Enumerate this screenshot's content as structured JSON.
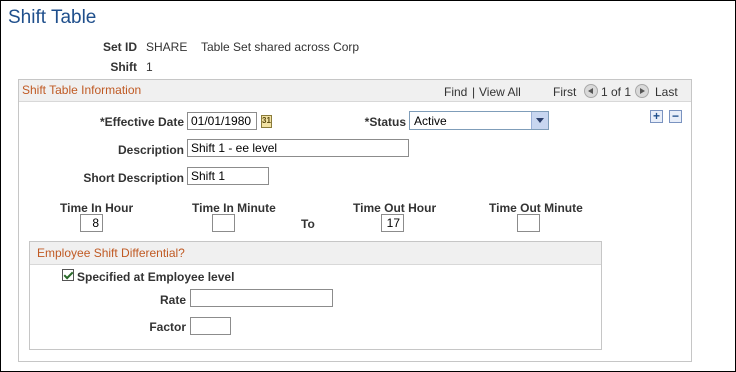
{
  "page": {
    "title": "Shift Table"
  },
  "header": {
    "setid_label": "Set ID",
    "setid_value": "SHARE",
    "setid_desc": "Table Set shared across Corp",
    "shift_label": "Shift",
    "shift_value": "1"
  },
  "group": {
    "title": "Shift Table Information",
    "find": "Find",
    "sep": "|",
    "view_all": "View All",
    "first": "First",
    "count": "1 of 1",
    "last": "Last"
  },
  "form": {
    "eff_date_label": "*Effective Date",
    "eff_date_value": "01/01/1980",
    "status_label": "*Status",
    "status_value": "Active",
    "description_label": "Description",
    "description_value": "Shift 1 - ee level",
    "short_desc_label": "Short Description",
    "short_desc_value": "Shift 1",
    "time_in_hour_label": "Time In Hour",
    "time_in_hour_value": "8",
    "time_in_minute_label": "Time In Minute",
    "time_in_minute_value": "",
    "to_label": "To",
    "time_out_hour_label": "Time Out Hour",
    "time_out_hour_value": "17",
    "time_out_minute_label": "Time Out Minute",
    "time_out_minute_value": ""
  },
  "differential": {
    "title": "Employee Shift Differential?",
    "checkbox_label": "Specified at Employee level",
    "checked": true,
    "rate_label": "Rate",
    "rate_value": "",
    "factor_label": "Factor",
    "factor_value": ""
  },
  "icons": {
    "add": "plus-icon",
    "delete": "minus-icon",
    "calendar": "calendar-icon",
    "prev": "previous-arrow-icon",
    "next": "next-arrow-icon"
  },
  "colors": {
    "title": "#1f4f8c",
    "section_caption": "#c05a24",
    "link": "#1f4f8c"
  }
}
